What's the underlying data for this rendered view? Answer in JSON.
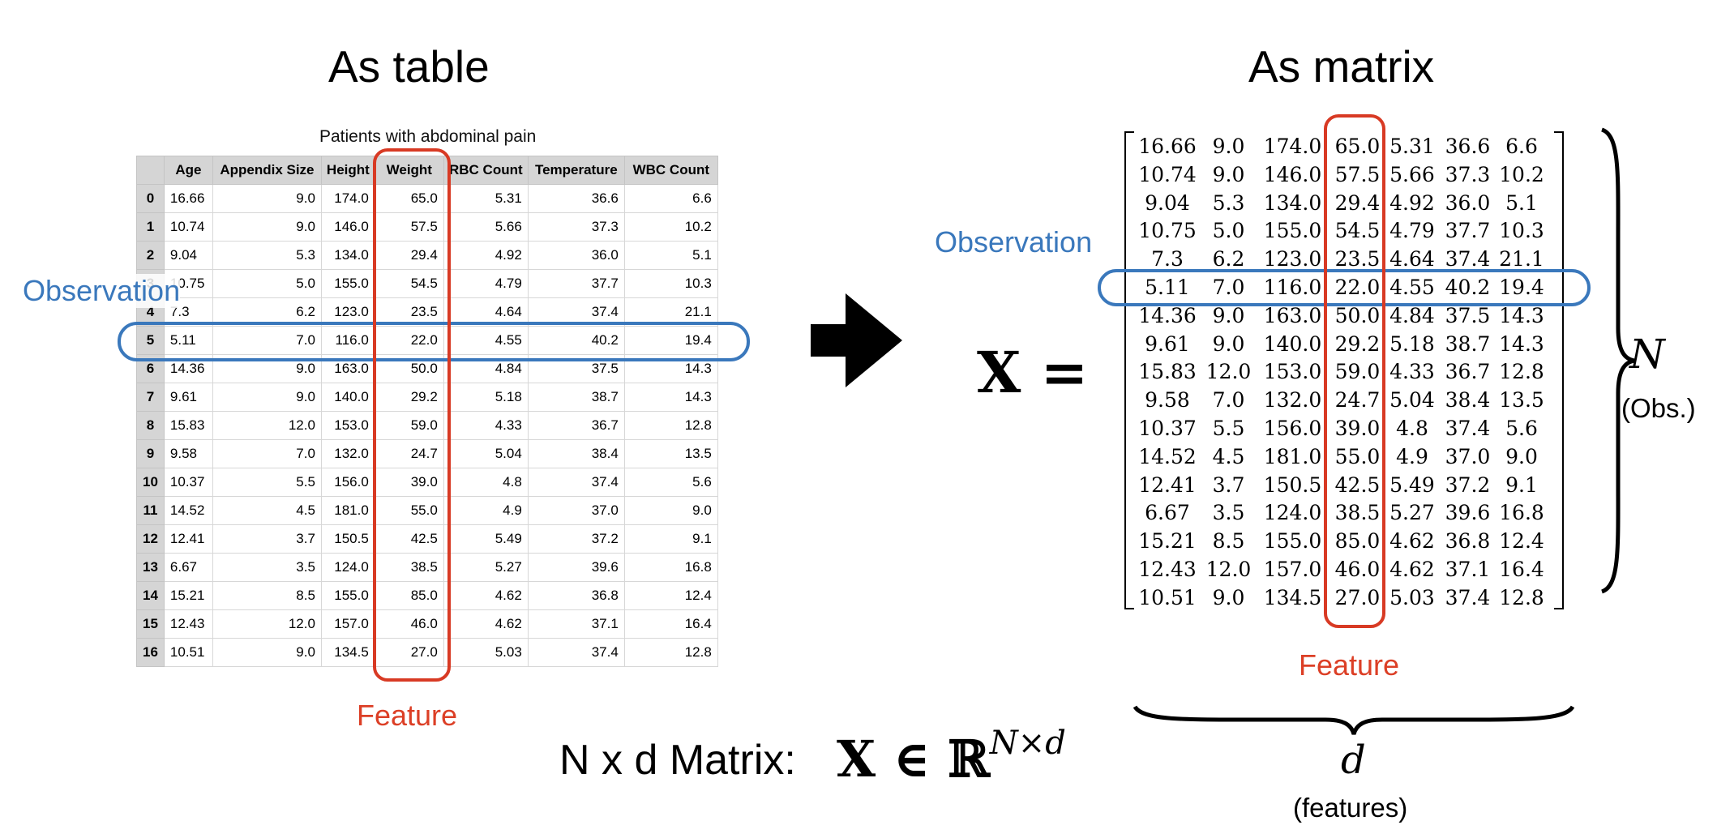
{
  "left": {
    "heading": "As table",
    "table_caption": "Patients with abdominal pain",
    "columns": [
      "Age",
      "Appendix Size",
      "Height",
      "Weight",
      "RBC Count",
      "Temperature",
      "WBC Count"
    ],
    "rows": [
      [
        "0",
        "16.66",
        "9.0",
        "174.0",
        "65.0",
        "5.31",
        "36.6",
        "6.6"
      ],
      [
        "1",
        "10.74",
        "9.0",
        "146.0",
        "57.5",
        "5.66",
        "37.3",
        "10.2"
      ],
      [
        "2",
        "9.04",
        "5.3",
        "134.0",
        "29.4",
        "4.92",
        "36.0",
        "5.1"
      ],
      [
        "3",
        "10.75",
        "5.0",
        "155.0",
        "54.5",
        "4.79",
        "37.7",
        "10.3"
      ],
      [
        "4",
        "7.3",
        "6.2",
        "123.0",
        "23.5",
        "4.64",
        "37.4",
        "21.1"
      ],
      [
        "5",
        "5.11",
        "7.0",
        "116.0",
        "22.0",
        "4.55",
        "40.2",
        "19.4"
      ],
      [
        "6",
        "14.36",
        "9.0",
        "163.0",
        "50.0",
        "4.84",
        "37.5",
        "14.3"
      ],
      [
        "7",
        "9.61",
        "9.0",
        "140.0",
        "29.2",
        "5.18",
        "38.7",
        "14.3"
      ],
      [
        "8",
        "15.83",
        "12.0",
        "153.0",
        "59.0",
        "4.33",
        "36.7",
        "12.8"
      ],
      [
        "9",
        "9.58",
        "7.0",
        "132.0",
        "24.7",
        "5.04",
        "38.4",
        "13.5"
      ],
      [
        "10",
        "10.37",
        "5.5",
        "156.0",
        "39.0",
        "4.8",
        "37.4",
        "5.6"
      ],
      [
        "11",
        "14.52",
        "4.5",
        "181.0",
        "55.0",
        "4.9",
        "37.0",
        "9.0"
      ],
      [
        "12",
        "12.41",
        "3.7",
        "150.5",
        "42.5",
        "5.49",
        "37.2",
        "9.1"
      ],
      [
        "13",
        "6.67",
        "3.5",
        "124.0",
        "38.5",
        "5.27",
        "39.6",
        "16.8"
      ],
      [
        "14",
        "15.21",
        "8.5",
        "155.0",
        "85.0",
        "4.62",
        "36.8",
        "12.4"
      ],
      [
        "15",
        "12.43",
        "12.0",
        "157.0",
        "46.0",
        "4.62",
        "37.1",
        "16.4"
      ],
      [
        "16",
        "10.51",
        "9.0",
        "134.5",
        "27.0",
        "5.03",
        "37.4",
        "12.8"
      ]
    ],
    "observation_label": "Observation",
    "feature_label": "Feature"
  },
  "right": {
    "heading": "As matrix",
    "equation_lhs": "X =",
    "observation_label": "Observation",
    "feature_label": "Feature",
    "n_symbol": "N",
    "n_caption": "(Obs.)",
    "d_symbol": "d",
    "d_caption": "(features)"
  },
  "bottom": {
    "label": "N x d Matrix:",
    "formula_main": "X ∈ ℝ",
    "formula_sup": "N×d"
  },
  "colors": {
    "observation": "#3a78bc",
    "feature": "#d83a24",
    "header_bg": "#d5d5d5"
  },
  "icons": {
    "arrow": "right-arrow-icon"
  }
}
